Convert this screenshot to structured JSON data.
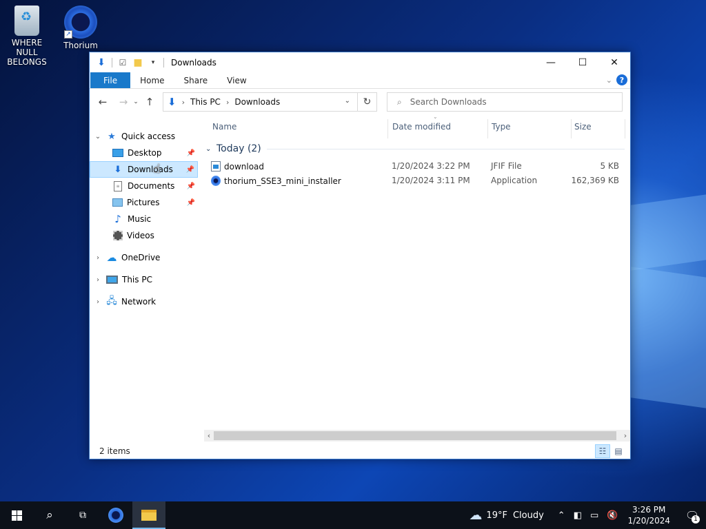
{
  "desktop": {
    "icons": [
      {
        "label": "WHERE NULL BELONGS"
      },
      {
        "label": "Thorium"
      }
    ]
  },
  "window": {
    "title": "Downloads",
    "controls": {
      "minimize": "—",
      "maximize": "☐",
      "close": "✕"
    }
  },
  "ribbon": {
    "tabs": [
      "File",
      "Home",
      "Share",
      "View"
    ],
    "help_label": "?"
  },
  "address": {
    "crumbs": [
      "This PC",
      "Downloads"
    ]
  },
  "search": {
    "placeholder": "Search Downloads"
  },
  "nav": {
    "quick_access": "Quick access",
    "pinned": [
      "Desktop",
      "Downloads",
      "Documents",
      "Pictures"
    ],
    "unpinned": [
      "Music",
      "Videos"
    ],
    "roots": [
      "OneDrive",
      "This PC",
      "Network"
    ],
    "selected": "Downloads"
  },
  "columns": {
    "name": "Name",
    "date": "Date modified",
    "type": "Type",
    "size": "Size"
  },
  "group": {
    "title": "Today (2)"
  },
  "files": [
    {
      "name": "download",
      "date": "1/20/2024 3:22 PM",
      "type": "JFIF File",
      "size": "5 KB",
      "icon": "jfif-file-icon"
    },
    {
      "name": "thorium_SSE3_mini_installer",
      "date": "1/20/2024 3:11 PM",
      "type": "Application",
      "size": "162,369 KB",
      "icon": "thorium-app-icon"
    }
  ],
  "status": {
    "count": "2 items"
  },
  "taskbar": {
    "weather_temp": "19°F",
    "weather_text": "Cloudy",
    "time": "3:26 PM",
    "date": "1/20/2024",
    "notification_count": "1"
  }
}
